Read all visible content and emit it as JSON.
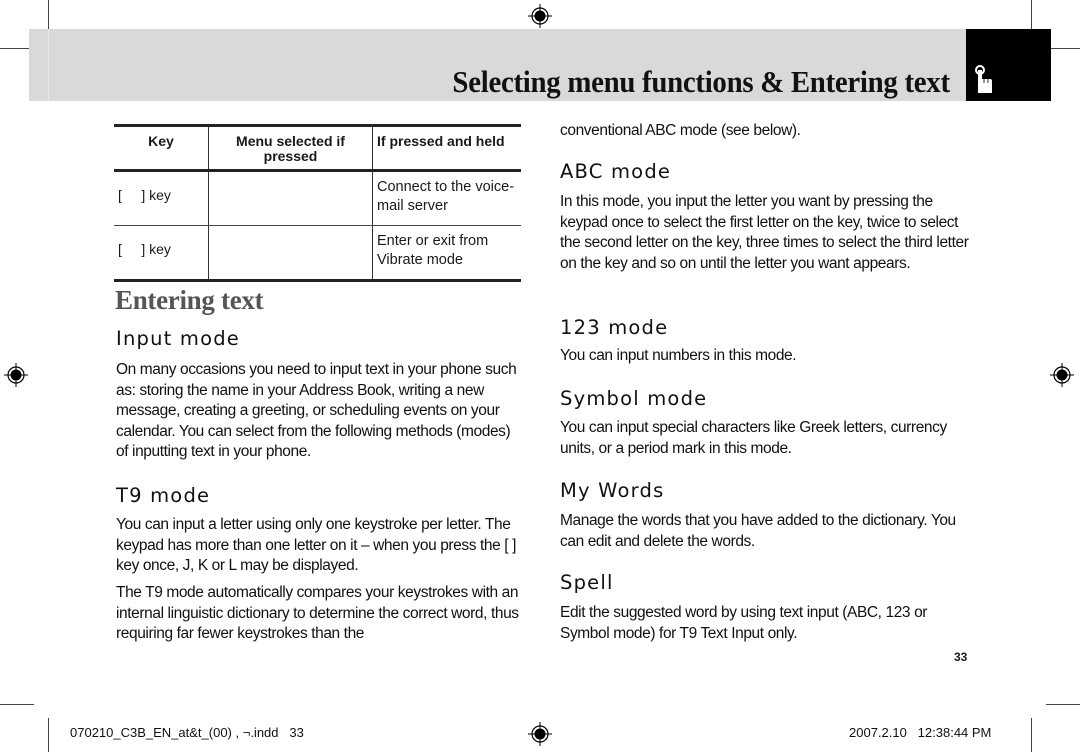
{
  "header": {
    "title": "Selecting menu functions & Entering text",
    "tab_icon": "pointing-hand-icon"
  },
  "key_table": {
    "headers": [
      "Key",
      "Menu selected if pressed",
      "If pressed and held"
    ],
    "rows": [
      {
        "key": "[     ] key",
        "menu": "",
        "held": "Connect to the voice-mail server"
      },
      {
        "key": "[     ] key",
        "menu": "",
        "held": "Enter or exit from Vibrate mode"
      }
    ]
  },
  "left": {
    "section_title": "Entering text",
    "input_mode": {
      "title": "Input mode",
      "body": "On many occasions you need to input text in your phone such as: storing the name in your Address Book, writing a new message, creating a greeting, or scheduling events on your calendar. You can select from the following methods (modes) of inputting text in your phone."
    },
    "t9_mode": {
      "title": "T9 mode",
      "body1": "You can input a letter using only one keystroke per letter. The keypad has more than one letter on it – when you press the [     ] key once, J, K or L may be displayed.",
      "body2": "The T9 mode automatically compares your keystrokes with an internal linguistic dictionary to determine the correct word, thus requiring far fewer keystrokes than the"
    }
  },
  "right": {
    "continued": "conventional ABC mode (see below).",
    "abc_mode": {
      "title": "ABC mode",
      "body": "In this mode, you input the letter you want by pressing the keypad once to select the first letter on the key, twice to select the second letter on the key, three times to select the third letter on the key and so on until the letter you want appears."
    },
    "num_mode": {
      "title": "123 mode",
      "body": "You can input numbers in this mode."
    },
    "symbol_mode": {
      "title": "Symbol mode",
      "body": "You can input special characters like Greek letters, currency units, or a period mark in this mode."
    },
    "my_words": {
      "title": "My Words",
      "body": "Manage the words that you have added to the dictionary. You can edit and delete the words."
    },
    "spell": {
      "title": "Spell",
      "body": "Edit the suggested word by using text input (ABC, 123 or Symbol mode) for T9 Text Input only."
    }
  },
  "page_number": "33",
  "footer": {
    "file_slug": "070210_C3B_EN_at&t_(00) , ¬.indd   33",
    "timestamp": "2007.2.10   12:38:44 PM"
  },
  "colors": {
    "header_band": "#d9d9d9",
    "tab_block": "#000000",
    "section_title": "#555555"
  }
}
